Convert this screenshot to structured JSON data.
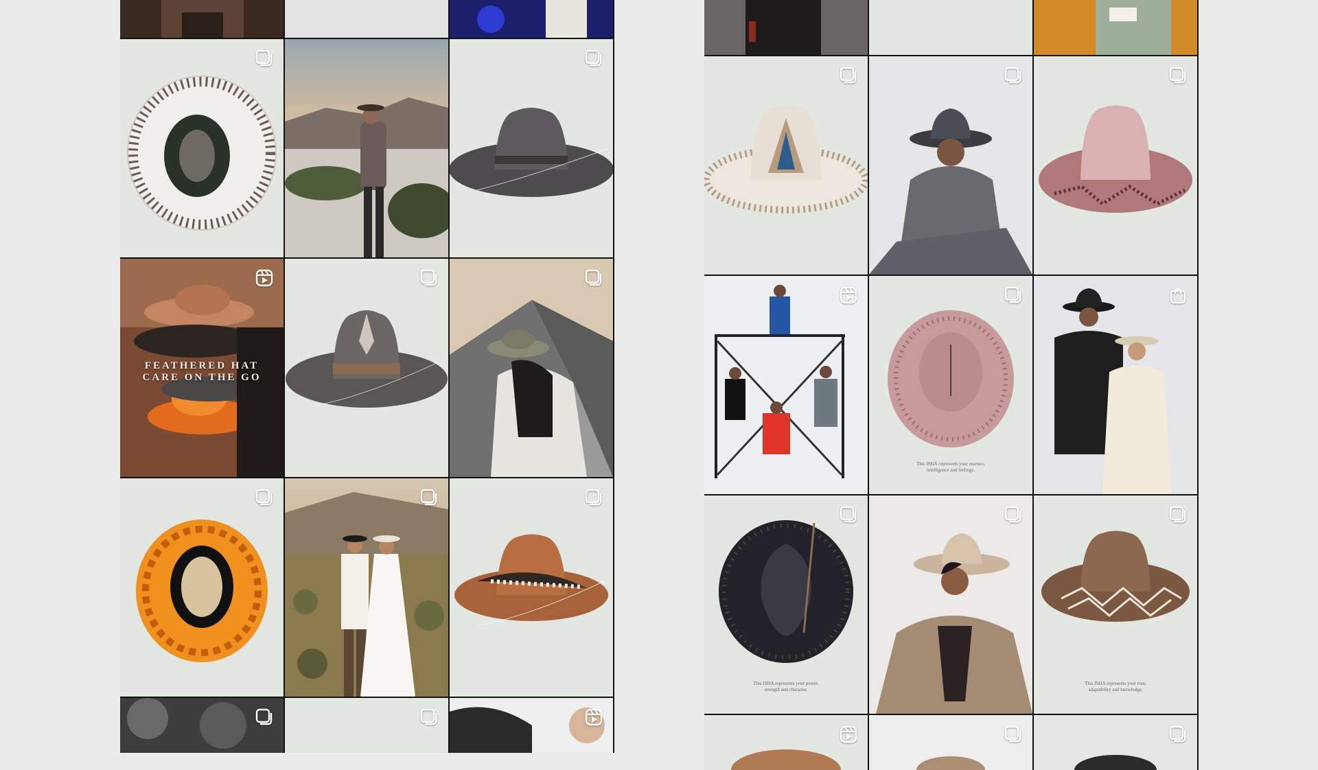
{
  "colors": {
    "background": "#ececec",
    "product_bg": "#e2e7e2",
    "badge": "#ffffff"
  },
  "left_grid": {
    "reel_overlay_line1": "FEATHERED HAT",
    "reel_overlay_line2": "CARE ON THE GO"
  },
  "right_grid": {
    "caption_pink_line1": "This ISHA represents your essence,",
    "caption_pink_line2": "intelligence and feelings.",
    "caption_black_line1": "This ISHA represents your power,",
    "caption_black_line2": "strength and character.",
    "caption_brown_line1": "This ISHA represents your root,",
    "caption_brown_line2": "adaptability and knowledge."
  },
  "icons": {
    "carousel": "carousel-icon",
    "reel": "reel-icon",
    "shopping": "shopping-bag-icon"
  }
}
